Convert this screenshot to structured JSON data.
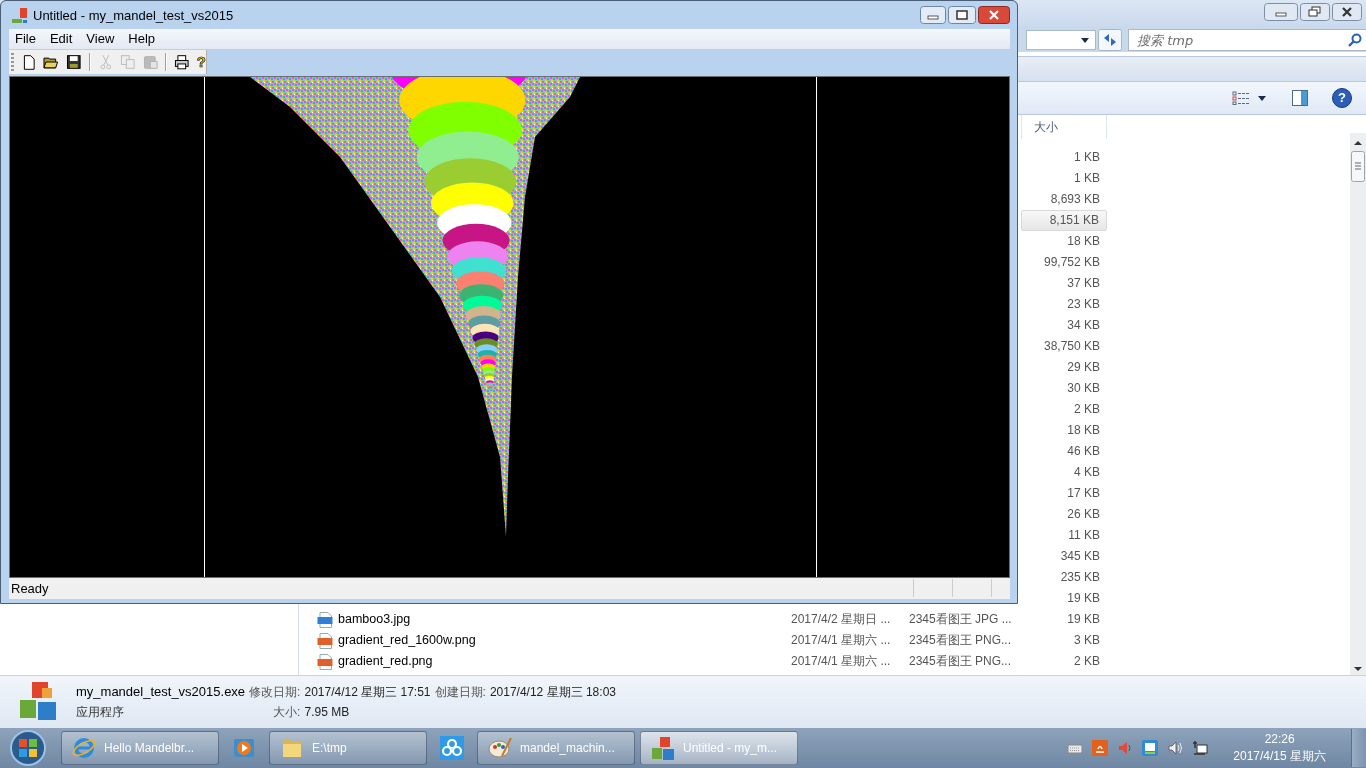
{
  "explorer": {
    "search": {
      "placeholder": "搜索 tmp"
    },
    "toolbar": {
      "help_glyph": "?"
    },
    "columns": [
      {
        "label": "大小"
      }
    ],
    "rows": [
      {
        "size": "1 KB",
        "selected": false
      },
      {
        "size": "1 KB",
        "selected": false
      },
      {
        "size": "8,693 KB",
        "selected": false
      },
      {
        "size": "8,151 KB",
        "selected": true
      },
      {
        "size": "18 KB",
        "selected": false
      },
      {
        "size": "99,752 KB",
        "selected": false
      },
      {
        "size": "37 KB",
        "selected": false
      },
      {
        "size": "23 KB",
        "selected": false
      },
      {
        "size": "34 KB",
        "selected": false
      },
      {
        "size": "38,750 KB",
        "selected": false
      },
      {
        "size": "29 KB",
        "selected": false
      },
      {
        "size": "30 KB",
        "selected": false
      },
      {
        "size": "2 KB",
        "selected": false
      },
      {
        "size": "18 KB",
        "selected": false
      },
      {
        "size": "46 KB",
        "selected": false
      },
      {
        "size": "4 KB",
        "selected": false
      },
      {
        "size": "17 KB",
        "selected": false
      },
      {
        "size": "26 KB",
        "selected": false
      },
      {
        "size": "11 KB",
        "selected": false
      },
      {
        "size": "345 KB",
        "selected": false
      },
      {
        "size": "235 KB",
        "selected": false
      },
      {
        "size": "19 KB",
        "selected": false
      },
      {
        "kind": "jpg",
        "name": "bamboo3.jpg",
        "date": "2017/4/2 星期日 ...",
        "type": "2345看图王 JPG ...",
        "size": "19 KB",
        "selected": false
      },
      {
        "kind": "png",
        "name": "gradient_red_1600w.png",
        "date": "2017/4/1 星期六 ...",
        "type": "2345看图王 PNG...",
        "size": "3 KB",
        "selected": false
      },
      {
        "kind": "png",
        "name": "gradient_red.png",
        "date": "2017/4/1 星期六 ...",
        "type": "2345看图王 PNG...",
        "size": "2 KB",
        "selected": false
      }
    ],
    "details": {
      "name": "my_mandel_test_vs2015.exe",
      "type": "应用程序",
      "fields": [
        {
          "label": "修改日期:",
          "value": "2017/4/12 星期三 17:51"
        },
        {
          "label": "创建日期:",
          "value": "2017/4/12 星期三 18:03"
        },
        {
          "label": "大小:",
          "value": "7.95 MB"
        }
      ]
    }
  },
  "app_window": {
    "title": "Untitled - my_mandel_test_vs2015",
    "menu": [
      {
        "label": "File"
      },
      {
        "label": "Edit"
      },
      {
        "label": "View"
      },
      {
        "label": "Help"
      }
    ],
    "toolbar": [
      [
        {
          "kind": "new",
          "disabled": false
        },
        {
          "kind": "open",
          "disabled": false
        },
        {
          "kind": "save",
          "disabled": false
        }
      ],
      [
        {
          "kind": "cut",
          "disabled": true
        },
        {
          "kind": "copy",
          "disabled": true
        },
        {
          "kind": "paste",
          "disabled": true
        }
      ],
      [
        {
          "kind": "print",
          "disabled": false
        },
        {
          "kind": "help",
          "glyph": "?",
          "disabled": false
        }
      ]
    ],
    "status": "Ready"
  },
  "taskbar": {
    "items": [
      {
        "kind": "ie",
        "label": "Hello Mandelbr...",
        "selected": false
      },
      {
        "kind": "media",
        "selected": false
      },
      {
        "kind": "folder",
        "label": "E:\\tmp",
        "selected": false
      },
      {
        "kind": "cloud",
        "selected": false
      },
      {
        "kind": "paint",
        "label": "mandel_machin...",
        "selected": false
      },
      {
        "kind": "mfc",
        "label": "Untitled - my_m...",
        "selected": true
      }
    ],
    "tray": [
      {
        "kind": "keyboard"
      },
      {
        "kind": "orange-app"
      },
      {
        "kind": "speaker-muted"
      },
      {
        "kind": "blue-app"
      },
      {
        "kind": "speaker"
      },
      {
        "kind": "network"
      }
    ],
    "clock": {
      "time": "22:26",
      "date": "2017/4/15 星期六"
    }
  }
}
